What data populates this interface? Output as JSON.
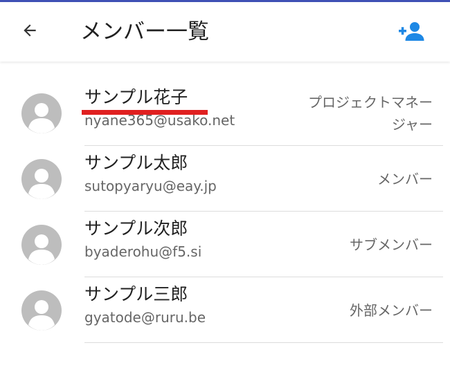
{
  "header": {
    "title": "メンバー一覧",
    "back_icon": "arrow-left-icon",
    "add_icon": "person-add-icon",
    "accent_color": "#1e88e5"
  },
  "members": [
    {
      "name": "サンプル花子",
      "email": "nyane365@usako.net",
      "role": "プロジェクトマネージャー"
    },
    {
      "name": "サンプル太郎",
      "email": "sutopyaryu@eay.jp",
      "role": "メンバー"
    },
    {
      "name": "サンプル次郎",
      "email": "byaderohu@f5.si",
      "role": "サブメンバー"
    },
    {
      "name": "サンプル三郎",
      "email": "gyatode@ruru.be",
      "role": "外部メンバー"
    }
  ]
}
